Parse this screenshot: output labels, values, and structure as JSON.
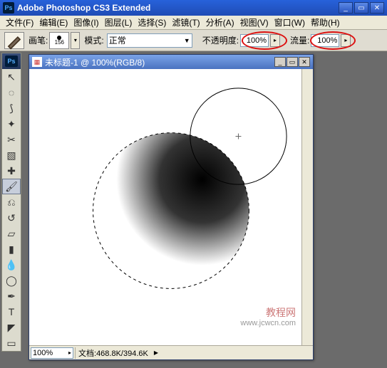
{
  "app": {
    "title": "Adobe Photoshop CS3 Extended",
    "logo": "Ps"
  },
  "menu": {
    "items": [
      "文件(F)",
      "编辑(E)",
      "图像(I)",
      "图层(L)",
      "选择(S)",
      "滤镜(T)",
      "分析(A)",
      "视图(V)",
      "窗口(W)",
      "帮助(H)"
    ]
  },
  "options": {
    "brush_label": "画笔:",
    "brush_size": "156",
    "mode_label": "模式:",
    "mode_value": "正常",
    "opacity_label": "不透明度:",
    "opacity_value": "100%",
    "flow_label": "流量:",
    "flow_value": "100%"
  },
  "toolbox": {
    "header": "Ps",
    "tools": [
      {
        "name": "move-tool",
        "glyph": "↖"
      },
      {
        "name": "marquee-tool",
        "glyph": "◌"
      },
      {
        "name": "lasso-tool",
        "glyph": "⟆"
      },
      {
        "name": "magic-wand-tool",
        "glyph": "✦"
      },
      {
        "name": "crop-tool",
        "glyph": "✂"
      },
      {
        "name": "slice-tool",
        "glyph": "▧"
      },
      {
        "name": "healing-brush-tool",
        "glyph": "✚"
      },
      {
        "name": "brush-tool",
        "glyph": "🖌",
        "selected": true
      },
      {
        "name": "clone-stamp-tool",
        "glyph": "⎌"
      },
      {
        "name": "history-brush-tool",
        "glyph": "↺"
      },
      {
        "name": "eraser-tool",
        "glyph": "▱"
      },
      {
        "name": "gradient-tool",
        "glyph": "▮"
      },
      {
        "name": "blur-tool",
        "glyph": "💧"
      },
      {
        "name": "dodge-tool",
        "glyph": "◯"
      },
      {
        "name": "pen-tool",
        "glyph": "✒"
      },
      {
        "name": "type-tool",
        "glyph": "T"
      },
      {
        "name": "path-selection-tool",
        "glyph": "◤"
      },
      {
        "name": "rectangle-tool",
        "glyph": "▭"
      }
    ]
  },
  "document": {
    "title": "未标题-1 @ 100%(RGB/8)",
    "zoom": "100%",
    "status_label": "文档:",
    "status_value": "468.8K/394.6K"
  },
  "watermark": {
    "line1": "教程网",
    "line2": "www.jcwcn.com"
  }
}
